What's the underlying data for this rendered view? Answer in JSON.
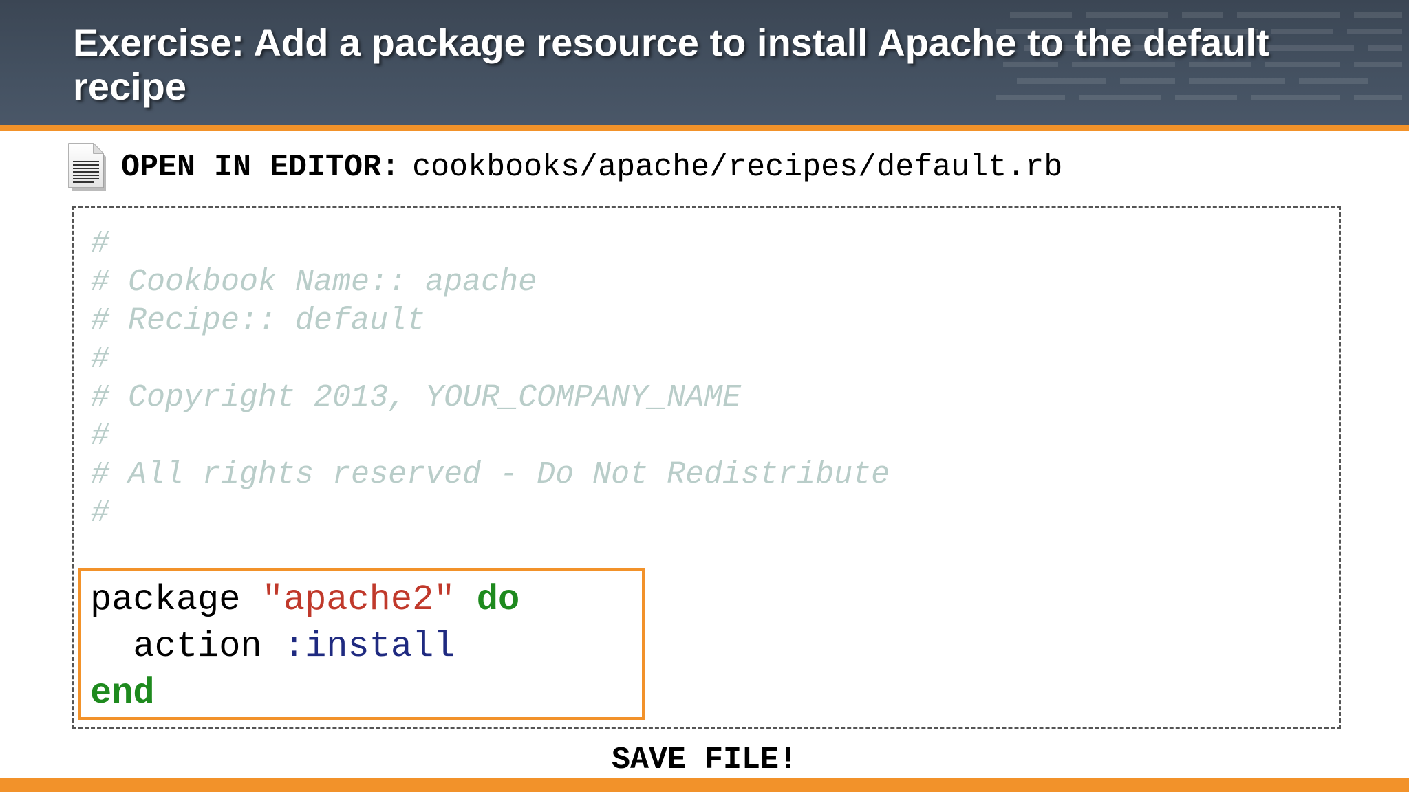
{
  "header": {
    "title": "Exercise:  Add a package resource to install Apache to the default recipe"
  },
  "open_in_editor": {
    "label": "OPEN IN EDITOR:",
    "path": "cookbooks/apache/recipes/default.rb",
    "icon": "document-icon"
  },
  "editor": {
    "comment_lines": [
      "#",
      "# Cookbook Name:: apache",
      "# Recipe:: default",
      "#",
      "# Copyright 2013, YOUR_COMPANY_NAME",
      "#",
      "# All rights reserved - Do Not Redistribute",
      "#"
    ],
    "code": {
      "line1": {
        "keyword_package": "package",
        "string": "\"apache2\"",
        "keyword_do": "do"
      },
      "line2": {
        "indent_method": "  action",
        "symbol": ":install"
      },
      "line3": {
        "keyword_end": "end"
      }
    }
  },
  "save_label": "SAVE FILE!",
  "colors": {
    "header_bg": "#445161",
    "accent_orange": "#f2922a",
    "comment_text": "#b9cdc9",
    "string_red": "#c0392b",
    "keyword_green": "#1e8a1e",
    "symbol_navy": "#1f2a80"
  }
}
